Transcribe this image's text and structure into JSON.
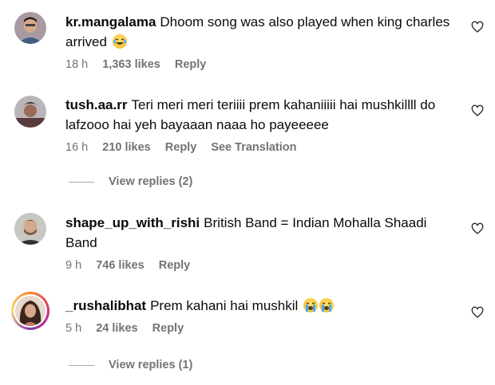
{
  "comments": [
    {
      "username": "kr.mangalama",
      "text": "Dhoom song was also played when king charles arrived",
      "emoji_icons": [
        "laughing-crying-emoji-icon"
      ],
      "time": "18 h",
      "likes": "1,363 likes",
      "reply_label": "Reply"
    },
    {
      "username": "tush.aa.rr",
      "text": "Teri meri meri teriiii prem kahaniiiii hai mushkillll do lafzooo hai yeh bayaaan naaa ho payeeeee",
      "time": "16 h",
      "likes": "210 likes",
      "reply_label": "Reply",
      "translate_label": "See Translation",
      "view_replies": "View replies (2)"
    },
    {
      "username": "shape_up_with_rishi",
      "text": "British Band = Indian Mohalla Shaadi Band",
      "time": "9 h",
      "likes": "746 likes",
      "reply_label": "Reply"
    },
    {
      "username": "_rushalibhat",
      "text": "Prem kahani hai mushkil",
      "emoji_icons": [
        "loudly-crying-emoji-icon",
        "loudly-crying-emoji-icon"
      ],
      "time": "5 h",
      "likes": "24 likes",
      "reply_label": "Reply",
      "view_replies": "View replies (1)"
    }
  ],
  "colors": {
    "meta_text": "#737373",
    "story_ring": [
      "#f58529",
      "#dd2a7b",
      "#8134af"
    ],
    "emoji_face": "#f9c635"
  }
}
